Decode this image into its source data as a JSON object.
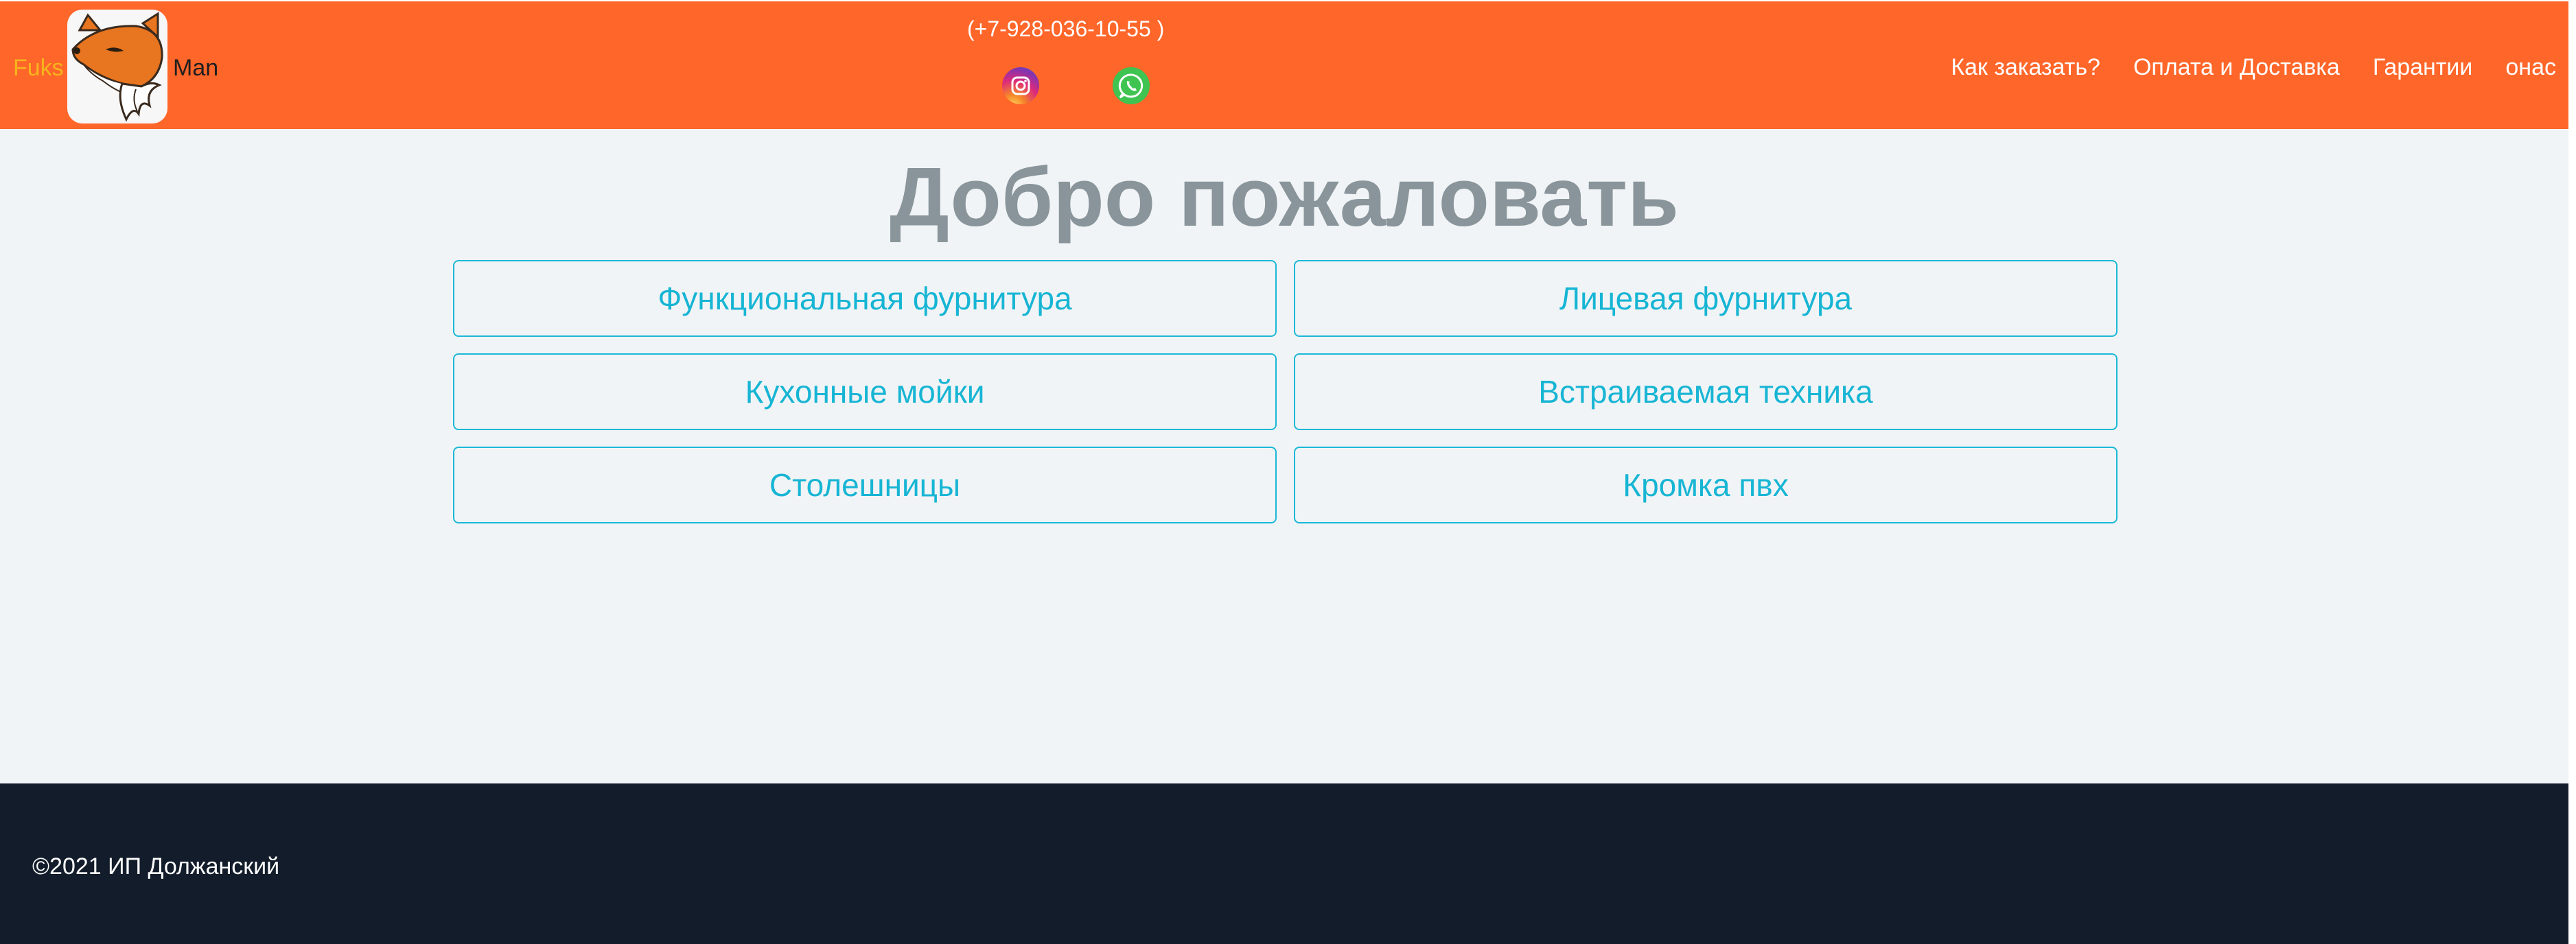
{
  "header": {
    "brand_left": "Fuks",
    "brand_right": "Man",
    "logo_icon": "fox-logo-icon",
    "phone": "(+7-928-036-10-55 )",
    "social": [
      {
        "name": "instagram-icon"
      },
      {
        "name": "whatsapp-icon"
      }
    ],
    "nav": [
      {
        "label": "Как заказать?"
      },
      {
        "label": "Оплата и Доставка"
      },
      {
        "label": "Гарантии"
      },
      {
        "label": "онас"
      }
    ],
    "colors": {
      "header_bg": "#ff6629",
      "brand_left": "#f5b41e"
    }
  },
  "main": {
    "title": "Добро пожаловать",
    "categories": [
      {
        "label": "Функциональная фурнитура"
      },
      {
        "label": "Лицевая фурнитура"
      },
      {
        "label": "Кухонные мойки"
      },
      {
        "label": "Встраиваемая техника"
      },
      {
        "label": "Столешницы"
      },
      {
        "label": "Кромка пвх"
      }
    ],
    "colors": {
      "accent": "#17b5d4",
      "title": "#89959b",
      "background": "#f1f4f6"
    }
  },
  "footer": {
    "copyright": "©2021 ИП Должанский",
    "colors": {
      "background": "#121c2a"
    }
  }
}
